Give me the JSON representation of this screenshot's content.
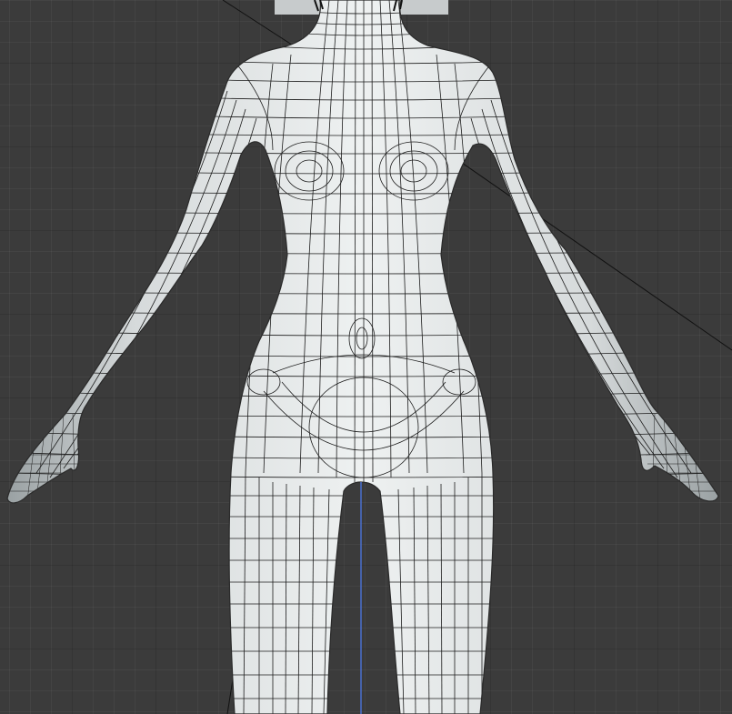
{
  "viewport": {
    "view": "front",
    "background_color": "#3b3b3b",
    "grid_visible": true,
    "grid_major_color": "#2a2a2a",
    "grid_minor_color": "#444444"
  },
  "model": {
    "type": "female-body-base-mesh",
    "display_mode": "wireframe-on-shaded",
    "surface_color": "#e4e8e9",
    "wire_color": "#1a1a1a"
  },
  "symmetry_axis": {
    "visible": true,
    "color": "#4a6fd0"
  },
  "reference_image": {
    "visible": true,
    "color": "#c7cbcc"
  },
  "guide_lines": {
    "visible": true,
    "color": "#111111"
  },
  "icons": [
    "viewport-grid",
    "symmetry-axis-line",
    "reference-plane"
  ]
}
